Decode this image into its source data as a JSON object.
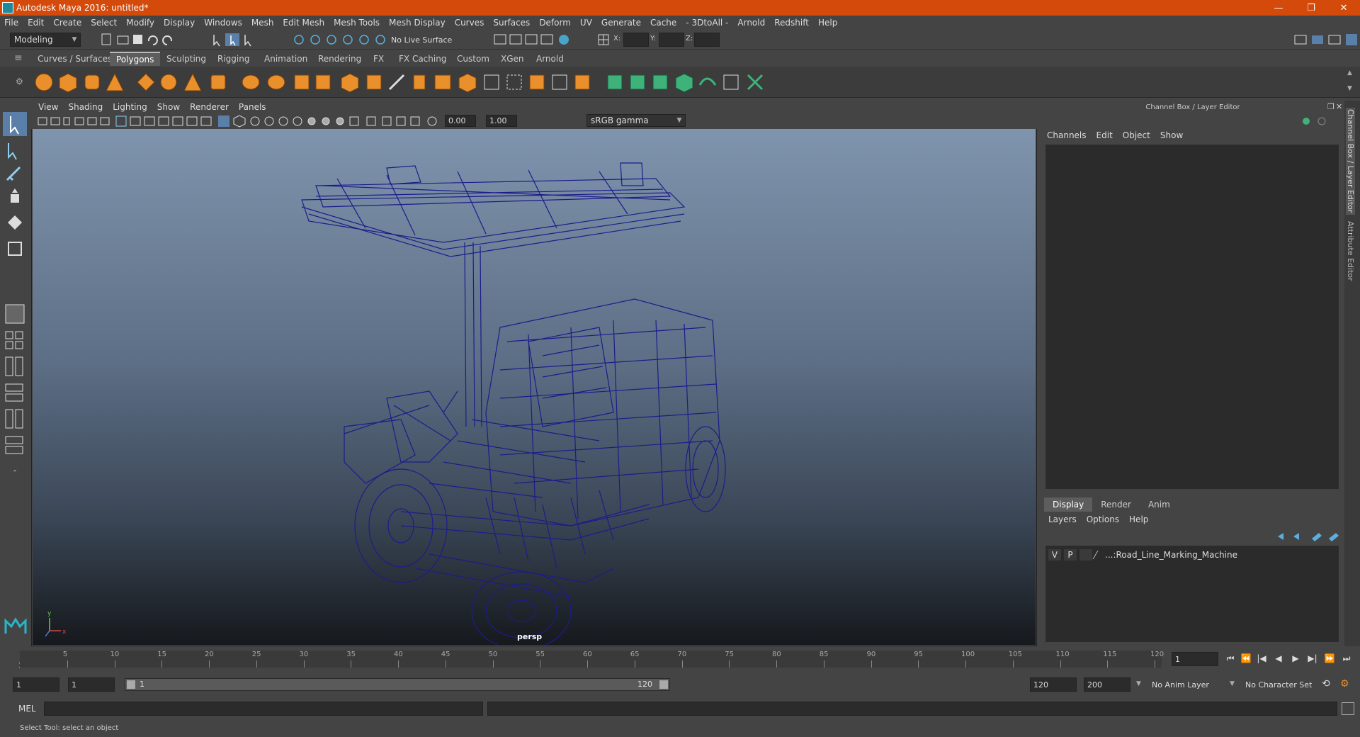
{
  "window": {
    "title": "Autodesk Maya 2016: untitled*",
    "minimize": "—",
    "restore": "❐",
    "close": "✕"
  },
  "menu": [
    "File",
    "Edit",
    "Create",
    "Select",
    "Modify",
    "Display",
    "Windows",
    "Mesh",
    "Edit Mesh",
    "Mesh Tools",
    "Mesh Display",
    "Curves",
    "Surfaces",
    "Deform",
    "UV",
    "Generate",
    "Cache",
    "- 3DtoAll -",
    "Arnold",
    "Redshift",
    "Help"
  ],
  "status_line": {
    "mode": "Modeling",
    "live_surface": "No Live Surface",
    "x_label": "X:",
    "y_label": "Y:",
    "z_label": "Z:"
  },
  "shelf_tabs": [
    "Curves / Surfaces",
    "Polygons",
    "Sculpting",
    "Rigging",
    "Animation",
    "Rendering",
    "FX",
    "FX Caching",
    "Custom",
    "XGen",
    "Arnold"
  ],
  "shelf_active": "Polygons",
  "viewport": {
    "menu": [
      "View",
      "Shading",
      "Lighting",
      "Show",
      "Renderer",
      "Panels"
    ],
    "exposure": "0.00",
    "gamma": "1.00",
    "color_space": "sRGB gamma",
    "camera_label": "persp",
    "wire_color": "#1c1c8a"
  },
  "channel_box": {
    "title": "Channel Box / Layer Editor",
    "menu": [
      "Channels",
      "Edit",
      "Object",
      "Show"
    ],
    "layer_tabs": [
      "Display",
      "Render",
      "Anim"
    ],
    "layer_menu": [
      "Layers",
      "Options",
      "Help"
    ],
    "layer": {
      "v": "V",
      "p": "P",
      "name": "...:Road_Line_Marking_Machine"
    }
  },
  "side_tabs": {
    "channel": "Channel Box / Layer Editor",
    "attribute": "Attribute Editor"
  },
  "timeline": {
    "ticks": [
      5,
      10,
      15,
      20,
      25,
      30,
      35,
      40,
      45,
      50,
      55,
      60,
      65,
      70,
      75,
      80,
      85,
      90,
      95,
      100,
      105,
      110,
      115,
      120
    ],
    "start_label": "1",
    "current_frame": "1",
    "playback": {
      "go_start": "⏮",
      "step_back_key": "⏪",
      "step_back": "|◀",
      "play_back": "◀",
      "play_fwd": "▶",
      "step_fwd": "▶|",
      "step_fwd_key": "⏩",
      "go_end": "⏭"
    }
  },
  "range": {
    "start": "1",
    "anim_start": "1",
    "range_start": "1",
    "range_end": "120",
    "end": "120",
    "anim_end": "200",
    "anim_layer": "No Anim Layer",
    "char_set": "No Character Set"
  },
  "command": {
    "label": "MEL"
  },
  "help_line": "Select Tool: select an object"
}
